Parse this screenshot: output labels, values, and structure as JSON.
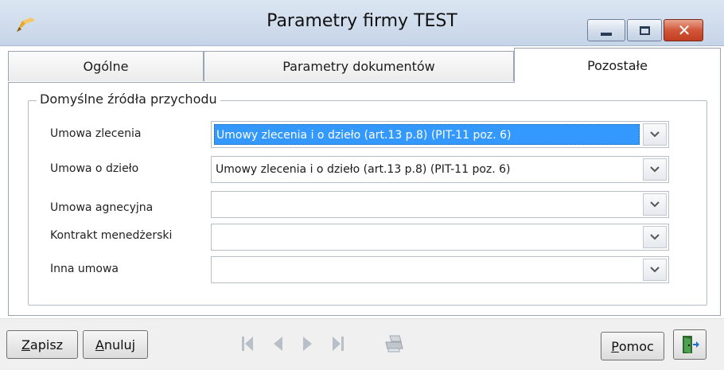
{
  "window": {
    "title": "Parametry firmy TEST",
    "icon": "pen-app-icon",
    "controls": {
      "minimize": "minimize-icon",
      "maximize": "maximize-icon",
      "close": "✕"
    }
  },
  "tabs": [
    {
      "label": "Ogólne",
      "active": false
    },
    {
      "label": "Parametry dokumentów",
      "active": false
    },
    {
      "label": "Pozostałe",
      "active": true
    }
  ],
  "group": {
    "title": "Domyślne źródła przychodu",
    "rows": [
      {
        "label": "Umowa zlecenia",
        "value": "Umowy zlecenia i o dzieło (art.13 p.8) (PIT-11 poz. 6)",
        "selected": true
      },
      {
        "label": "Umowa o dzieło",
        "value": "Umowy zlecenia i o dzieło (art.13 p.8) (PIT-11 poz. 6)",
        "selected": false
      },
      {
        "label": "Umowa agnecyjna",
        "value": "",
        "selected": false
      },
      {
        "label": "Kontrakt menedżerski",
        "value": "",
        "selected": false
      },
      {
        "label": "Inna umowa",
        "value": "",
        "selected": false
      }
    ]
  },
  "footer": {
    "save": {
      "accel": "Z",
      "rest": "apisz"
    },
    "cancel": {
      "accel": "A",
      "rest": "nuluj"
    },
    "help": {
      "accel": "P",
      "rest": "omoc"
    },
    "nav_icons": [
      "first-record-icon",
      "previous-record-icon",
      "next-record-icon",
      "last-record-icon"
    ],
    "print_icon": "printer-icon",
    "exit_icon": "exit-door-icon"
  },
  "colors": {
    "selection": "#3399ff",
    "titlebar": "#cfdcec",
    "close_button": "#d2573a"
  }
}
